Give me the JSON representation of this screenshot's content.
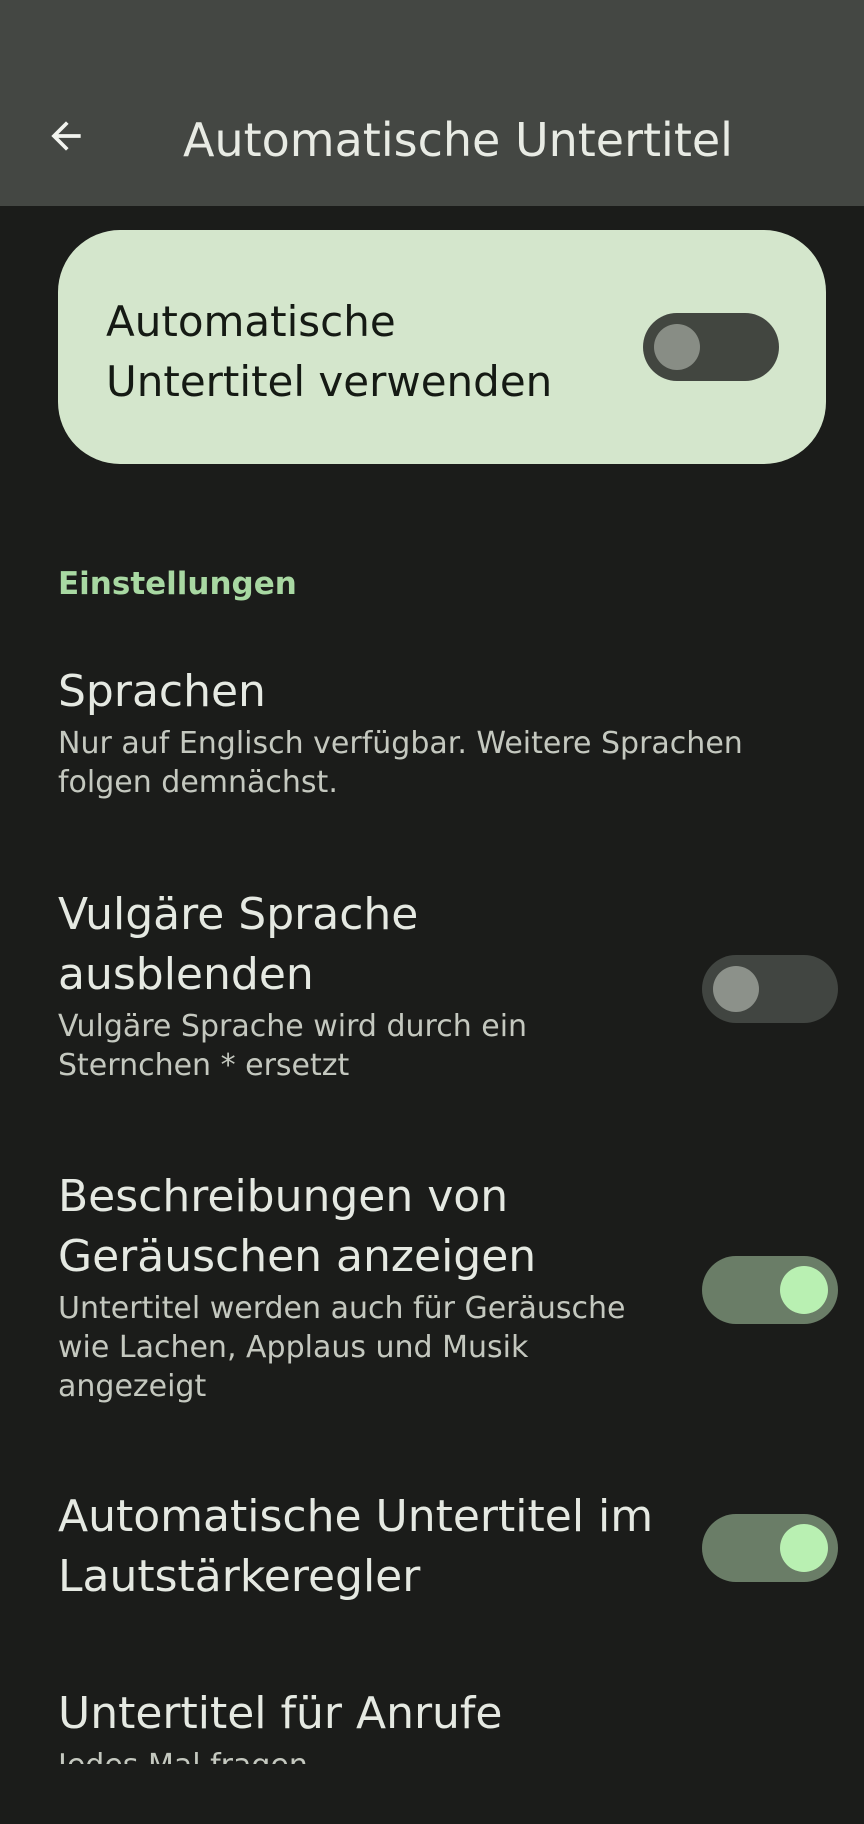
{
  "app_bar": {
    "title": "Automatische Untertitel",
    "back_icon": "arrow-back-icon",
    "background": "#444743"
  },
  "main_toggle": {
    "label": "Automatische Untertitel verwenden",
    "checked": false
  },
  "section": {
    "header": "Einstellungen"
  },
  "preferences": [
    {
      "title": "Sprachen",
      "summary": "Nur auf Englisch verfügbar. Weitere Sprachen folgen demnächst."
    },
    {
      "title": "Vulgäre Sprache ausblenden",
      "summary": "Vulgäre Sprache wird durch ein Sternchen * ersetzt",
      "checked": false
    },
    {
      "title": "Beschreibungen von Geräuschen anzeigen",
      "summary": "Untertitel werden auch für Geräusche wie Lachen, Applaus und Musik angezeigt",
      "checked": true
    },
    {
      "title": "Automatische Untertitel im Lautstärkeregler",
      "checked": true
    },
    {
      "title": "Untertitel für Anrufe",
      "summary": "Jedes Mal fragen"
    }
  ],
  "colors": {
    "accent": "#a8d8a2",
    "card_background": "#d4e6cc",
    "switch_on_thumb": "#b9f0b2",
    "page_background": "#1b1c1a"
  }
}
